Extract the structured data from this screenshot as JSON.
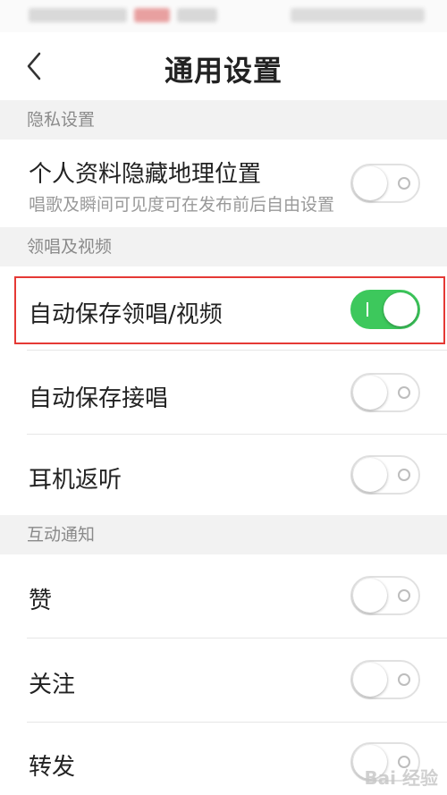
{
  "nav": {
    "title": "通用设置"
  },
  "sections": [
    {
      "header": "隐私设置"
    },
    {
      "header": "领唱及视频"
    },
    {
      "header": "互动通知"
    }
  ],
  "rows": {
    "hide_location": {
      "label": "个人资料隐藏地理位置",
      "sub": "唱歌及瞬间可见度可在发布前后自由设置",
      "on": false
    },
    "auto_save_lead": {
      "label": "自动保存领唱/视频",
      "on": true
    },
    "auto_save_join": {
      "label": "自动保存接唱",
      "on": false
    },
    "earphone_monitor": {
      "label": "耳机返听",
      "on": false
    },
    "like": {
      "label": "赞",
      "on": false
    },
    "follow": {
      "label": "关注",
      "on": false
    },
    "repost": {
      "label": "转发",
      "on": false
    }
  },
  "colors": {
    "toggle_on": "#3dc85c",
    "highlight": "#e53935"
  },
  "watermark": "Bai 经验"
}
